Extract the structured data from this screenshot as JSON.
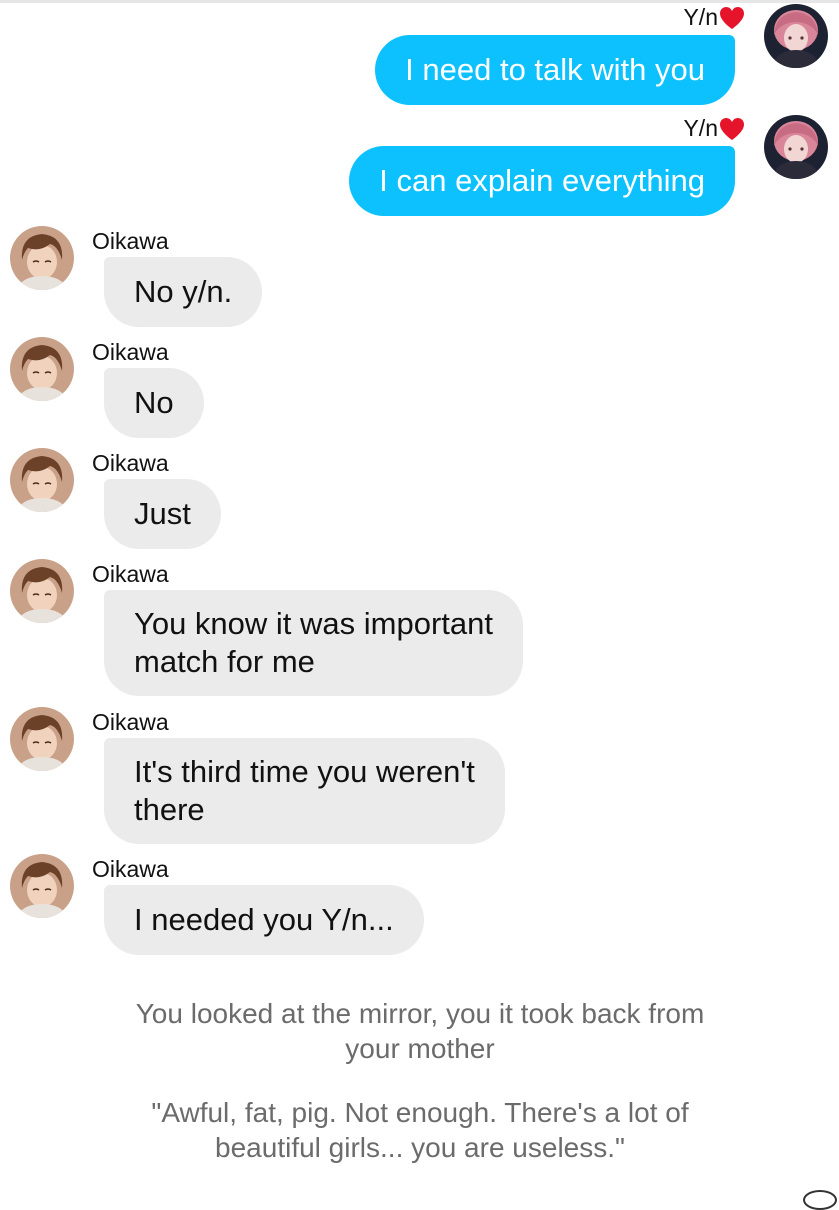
{
  "conversation": {
    "sent": [
      {
        "sender": "Y/n",
        "text": "I need to talk with you"
      },
      {
        "sender": "Y/n",
        "text": "I can explain everything"
      }
    ],
    "received": [
      {
        "sender": "Oikawa",
        "lines": [
          "No y/n."
        ]
      },
      {
        "sender": "Oikawa",
        "lines": [
          "No"
        ]
      },
      {
        "sender": "Oikawa",
        "lines": [
          "Just"
        ]
      },
      {
        "sender": "Oikawa",
        "lines": [
          "You know it was important",
          "match for me"
        ]
      },
      {
        "sender": "Oikawa",
        "lines": [
          "It's third time you weren't",
          "there"
        ]
      },
      {
        "sender": "Oikawa",
        "lines": [
          "I needed you Y/n..."
        ]
      }
    ]
  },
  "narration": {
    "paragraph_1": [
      "You looked at the mirror, you it took back from",
      "your mother"
    ],
    "paragraph_2": [
      "\"Awful, fat, pig. Not enough. There's a lot of",
      "beautiful girls... you are useless.\""
    ]
  },
  "icons": {
    "sender_suffix": "heart-icon",
    "avatar_sent": "avatar-pink-hair",
    "avatar_received": "avatar-brown-hair"
  },
  "colors": {
    "sent_bubble": "#0dc1ff",
    "received_bubble": "#ebebeb",
    "heart": "#e5142b",
    "narration_text": "#6b6b6b"
  }
}
